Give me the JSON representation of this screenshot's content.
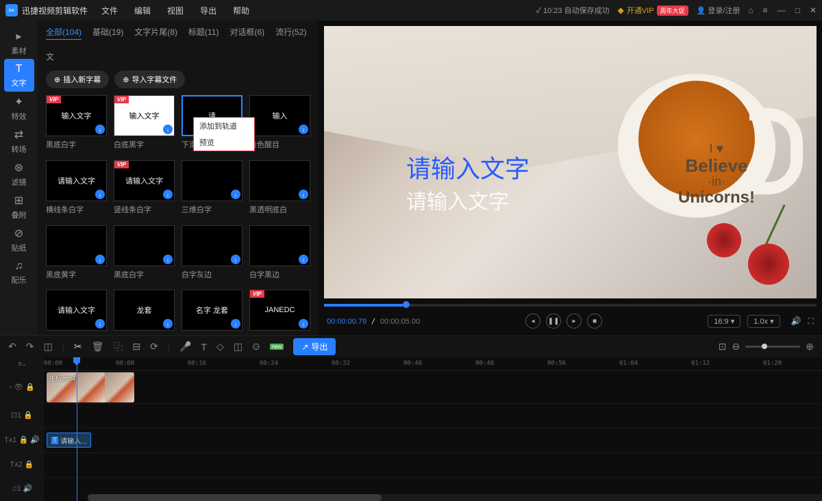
{
  "titlebar": {
    "app_name": "迅捷视频剪辑软件",
    "menus": [
      "文件",
      "编辑",
      "视图",
      "导出",
      "帮助"
    ],
    "save_time": "10:23",
    "save_status": "自动保存成功",
    "vip_label": "开通VIP",
    "promo": "周年大促",
    "login": "登录/注册"
  },
  "sidebar": {
    "tabs": [
      {
        "icon": "▸",
        "label": "素材"
      },
      {
        "icon": "T",
        "label": "文字"
      },
      {
        "icon": "✦",
        "label": "特效"
      },
      {
        "icon": "⇄",
        "label": "转场"
      },
      {
        "icon": "⊛",
        "label": "滤镜"
      },
      {
        "icon": "⊞",
        "label": "叠附"
      },
      {
        "icon": "⊘",
        "label": "贴纸"
      },
      {
        "icon": "♫",
        "label": "配乐"
      }
    ],
    "active": 1
  },
  "categories": {
    "tabs": [
      {
        "label": "全部(104)",
        "active": true
      },
      {
        "label": "基础(19)"
      },
      {
        "label": "文字片尾(8)"
      },
      {
        "label": "标题(11)"
      },
      {
        "label": "对话框(6)"
      },
      {
        "label": "流行(52)"
      },
      {
        "label": "文"
      }
    ],
    "insert_btn": "插入新字幕",
    "import_btn": "导入字幕文件"
  },
  "context_menu": {
    "item1": "添加到轨道",
    "item2": "预览"
  },
  "cards": [
    {
      "thumb_text": "输入文字",
      "label": "黑底白字",
      "vip": true,
      "bg": "black"
    },
    {
      "thumb_text": "输入文字",
      "label": "白底黑字",
      "vip": true,
      "bg": "white"
    },
    {
      "thumb_text": "请",
      "label": "下滑白字",
      "vip": false,
      "selected": true,
      "has_menu": true
    },
    {
      "thumb_text": "输入",
      "label": "黄色醒目",
      "vip": false
    },
    {
      "thumb_text": "请输入文字",
      "label": "横线条白字",
      "vip": false
    },
    {
      "thumb_text": "请输入文字",
      "label": "竖线条白字",
      "vip": true
    },
    {
      "thumb_text": "",
      "label": "三维白字",
      "vip": false
    },
    {
      "thumb_text": "",
      "label": "黑透明底白",
      "vip": false
    },
    {
      "thumb_text": "",
      "label": "黑底黄字",
      "vip": false
    },
    {
      "thumb_text": "",
      "label": "黑底白字",
      "vip": false
    },
    {
      "thumb_text": "",
      "label": "白字灰边",
      "vip": false
    },
    {
      "thumb_text": "",
      "label": "白字黑边",
      "vip": false
    },
    {
      "thumb_text": "请输入文字",
      "label": "",
      "vip": false
    },
    {
      "thumb_text": "龙套",
      "label": "",
      "vip": false
    },
    {
      "thumb_text": "名字 龙套",
      "label": "",
      "vip": false
    },
    {
      "thumb_text": "JANEDC",
      "label": "",
      "vip": true
    }
  ],
  "preview": {
    "overlay_line1": "请输入文字",
    "overlay_line2": "请输入文字",
    "cup_line1": "I ♥",
    "cup_line2": "Believe",
    "cup_line3": "·in·",
    "cup_line4": "Unicorns!",
    "time_current": "00:00:00.79",
    "time_total": "00:00:05.00",
    "aspect": "16:9 ▾",
    "speed": "1.0x ▾"
  },
  "toolbar": {
    "export": "导出",
    "new": "new"
  },
  "timeline": {
    "ticks": [
      "00:00",
      "00:08",
      "00:16",
      "00:24",
      "00:32",
      "00:40",
      "00:48",
      "00:56",
      "01:04",
      "01:12",
      "01:20"
    ],
    "video_clip": "午后.mp4",
    "text_clip": "请输入...",
    "tracks": [
      {
        "icon": "≡₊",
        "label": ""
      },
      {
        "icon": "▫",
        "label": ""
      },
      {
        "icon": "⊡1",
        "label": ""
      },
      {
        "icon": "T",
        "label": "1"
      },
      {
        "icon": "T",
        "label": "2"
      },
      {
        "icon": "♫",
        "label": "1"
      }
    ]
  }
}
